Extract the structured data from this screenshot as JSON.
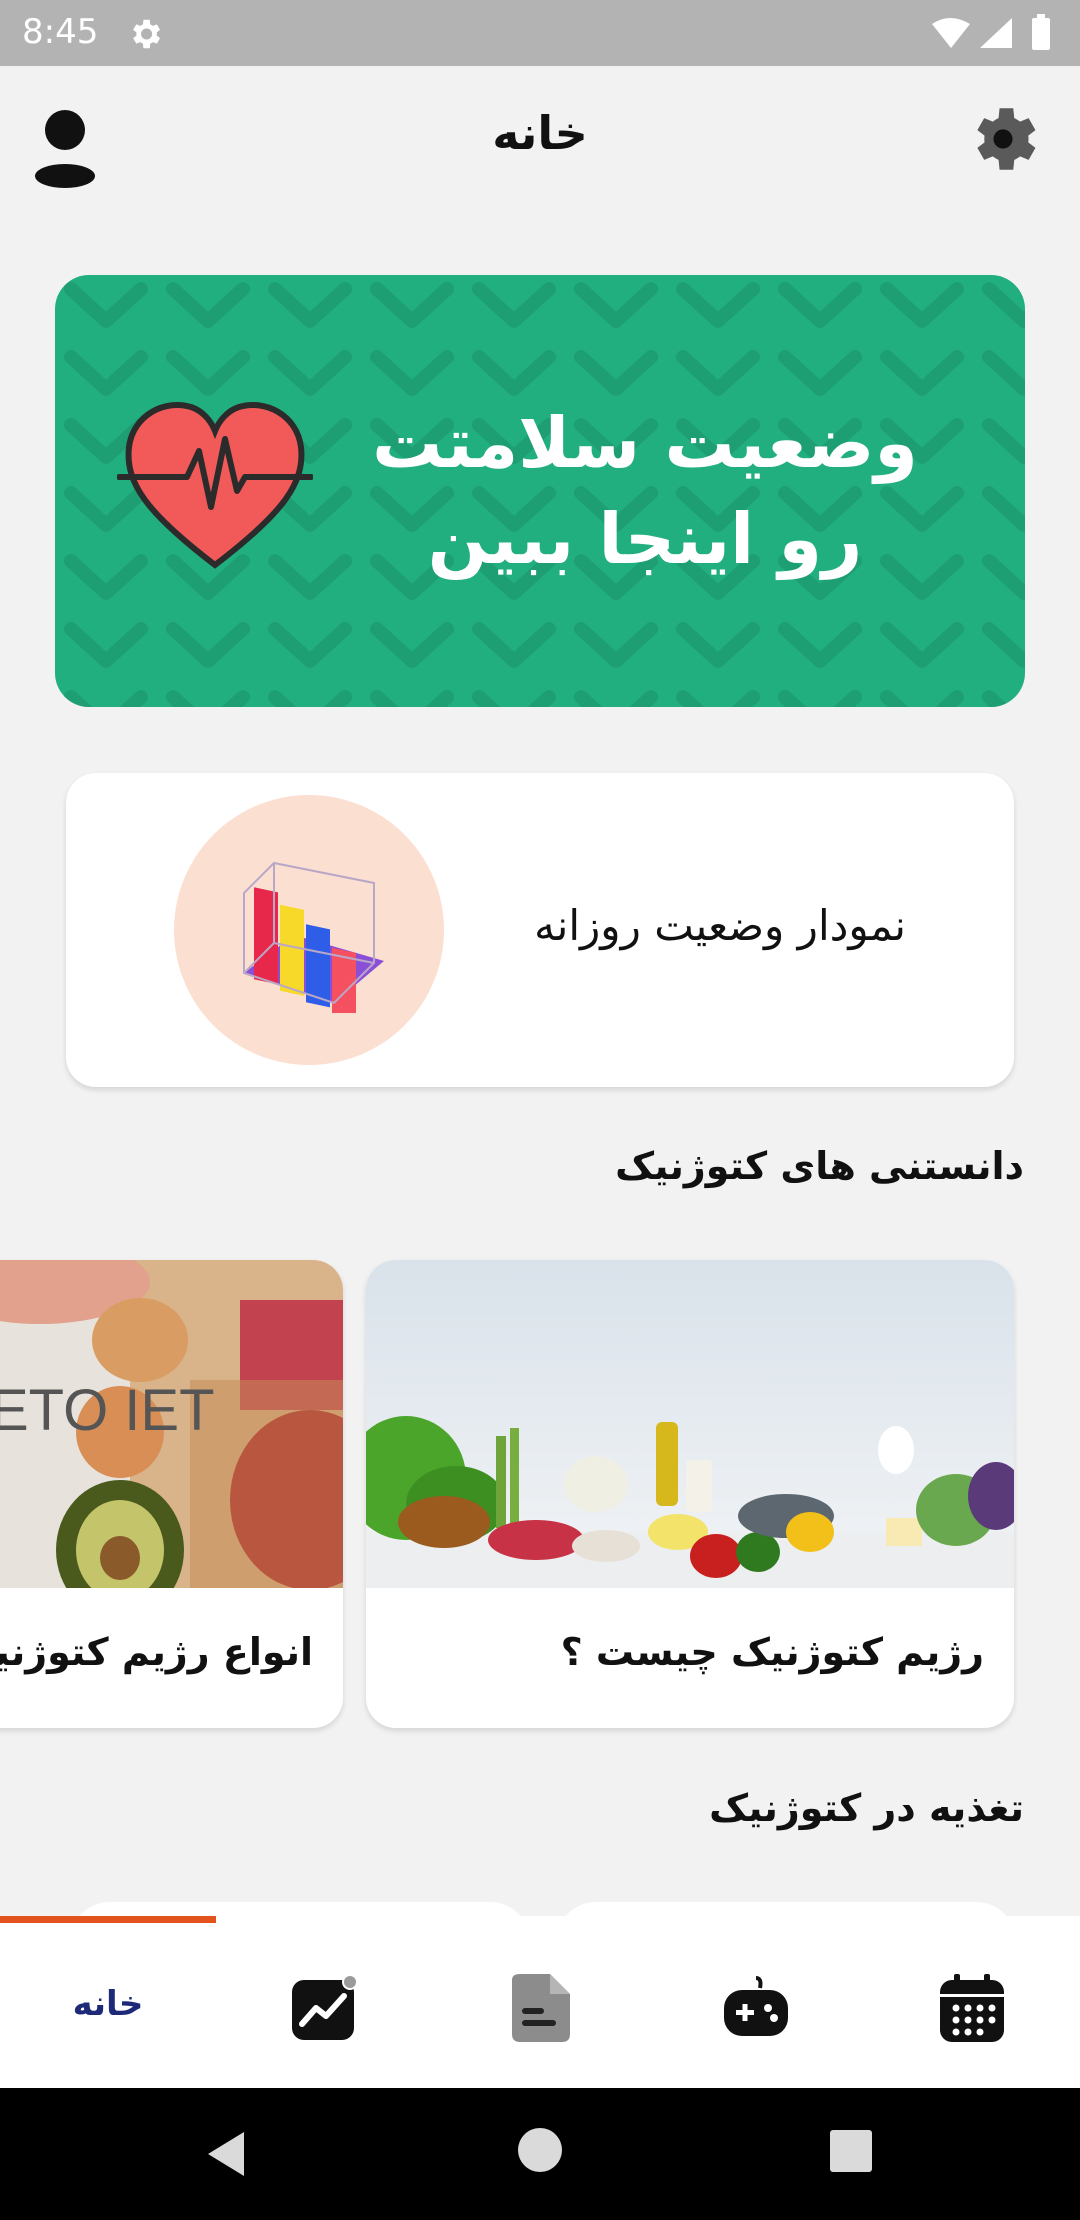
{
  "status_bar": {
    "time": "8:45"
  },
  "header": {
    "title": "خانه"
  },
  "banner": {
    "line1": "وضعیت سلامتت",
    "line2": "رو اینجا ببین"
  },
  "daily_chart": {
    "label": "نمودار وضعیت روزانه"
  },
  "keto_facts": {
    "title": "دانستنی های کتوژنیک",
    "articles": [
      {
        "title": "رژیم کتوژنیک چیست ؟"
      },
      {
        "title": "انواع رژیم کتوژنیک",
        "image_text": "ETO IET"
      }
    ]
  },
  "keto_nutrition": {
    "title": "تغذیه در کتوژنیک"
  },
  "bottom_nav": {
    "items": [
      {
        "label": "خانه",
        "icon": "home"
      },
      {
        "icon": "chart-icon"
      },
      {
        "icon": "document-icon"
      },
      {
        "icon": "gamepad-icon"
      },
      {
        "icon": "calendar-icon"
      }
    ]
  },
  "colors": {
    "accent": "#22af80",
    "nav_indicator": "#e2531d",
    "nav_label": "#1e2a78"
  }
}
